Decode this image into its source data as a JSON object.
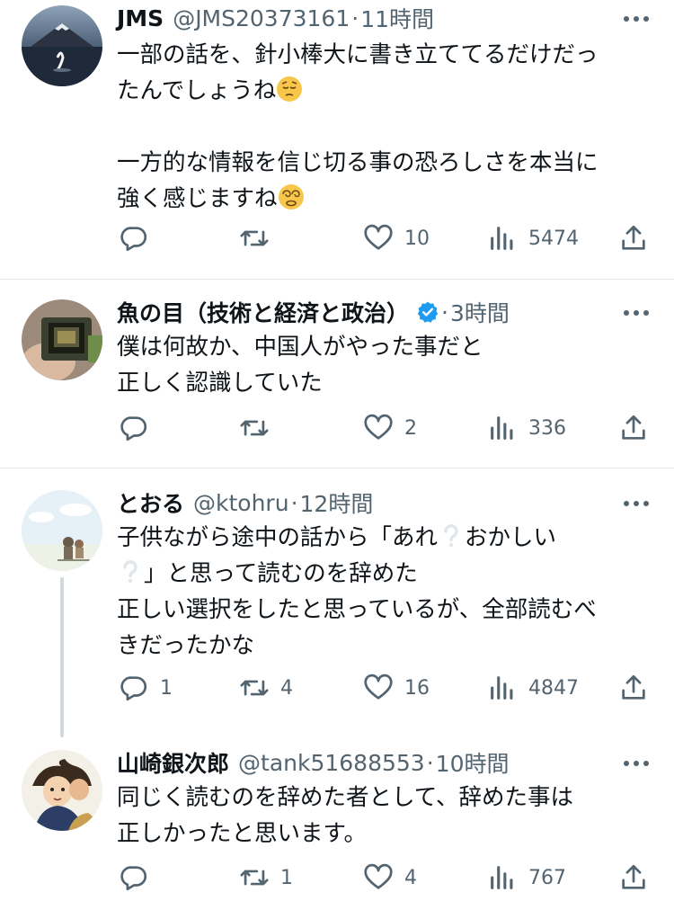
{
  "tweets": [
    {
      "name": "JMS",
      "handle": "@JMS20373161",
      "time": "11時間",
      "lines": [
        "一部の話を、針小棒大に書き立ててるだけだっ",
        "たんでしょうね",
        "",
        "一方的な情報を信じ切る事の恐ろしさを本当に",
        "強く感じますね"
      ],
      "emojis": [
        "pensive-face",
        "dizzy-face"
      ],
      "replies": "",
      "retweets": "",
      "likes": "10",
      "views": "5474"
    },
    {
      "name": "魚の目（技術と経済と政治）",
      "handle": "",
      "time": "3時間",
      "verified": true,
      "lines": [
        "僕は何故か、中国人がやった事だと",
        "正しく認識していた"
      ],
      "replies": "",
      "retweets": "",
      "likes": "2",
      "views": "336"
    },
    {
      "name": "とおる",
      "handle": "@ktohru",
      "time": "12時間",
      "lines": [
        "子供ながら途中の話から「あれ",
        "おかしい",
        "」と思って読むのを辞めた",
        "正しい選択をしたと思っているが、全部読むべ",
        "きだったかな"
      ],
      "emojis": [
        "white-question-mark"
      ],
      "replies": "1",
      "retweets": "4",
      "likes": "16",
      "views": "4847"
    },
    {
      "name": "山崎銀次郎",
      "handle": "@tank51688553",
      "time": "10時間",
      "lines": [
        "同じく読むのを辞めた者として、辞めた事は",
        "正しかったと思います。"
      ],
      "replies": "",
      "retweets": "1",
      "likes": "4",
      "views": "767"
    }
  ],
  "colors": {
    "text": "#0f1419",
    "secondary": "#536471",
    "verified": "#1d9bf0",
    "divider": "#e6e9ec"
  }
}
